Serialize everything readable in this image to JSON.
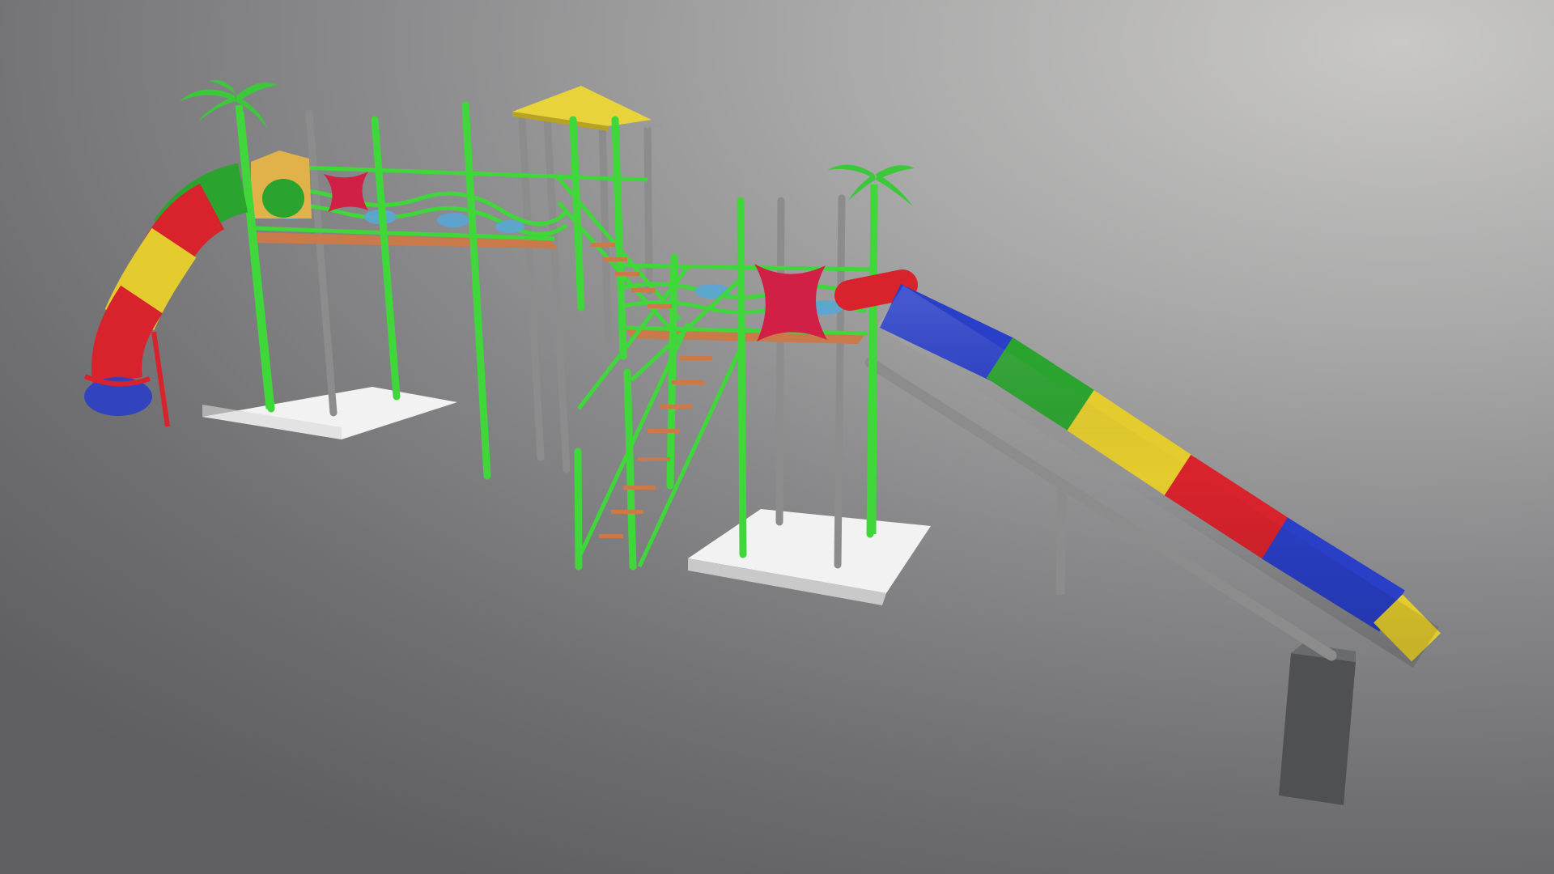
{
  "scene": {
    "subject": "playground-water-slide-3d-model",
    "colors": {
      "pipe_green": "#3fd73a",
      "pipe_grey": "#8c8c8c",
      "deck_wood": "#c9794a",
      "roof_yellow": "#e8d33a",
      "slide_red": "#d8232d",
      "slide_yellow": "#e4cc2e",
      "slide_blue": "#2a3fc7",
      "slide_green": "#2ba32f",
      "panel_red": "#d21f46",
      "wave_blue": "#5aa6d6",
      "pad_white": "#f2f2f2",
      "pier_grey": "#4f5052"
    },
    "straight_slide_segments": [
      "slide_blue",
      "slide_green",
      "slide_yellow",
      "slide_red",
      "slide_blue",
      "slide_yellow"
    ],
    "curved_slide_segments": [
      "slide_green",
      "slide_red",
      "slide_yellow",
      "slide_red",
      "slide_blue"
    ]
  }
}
